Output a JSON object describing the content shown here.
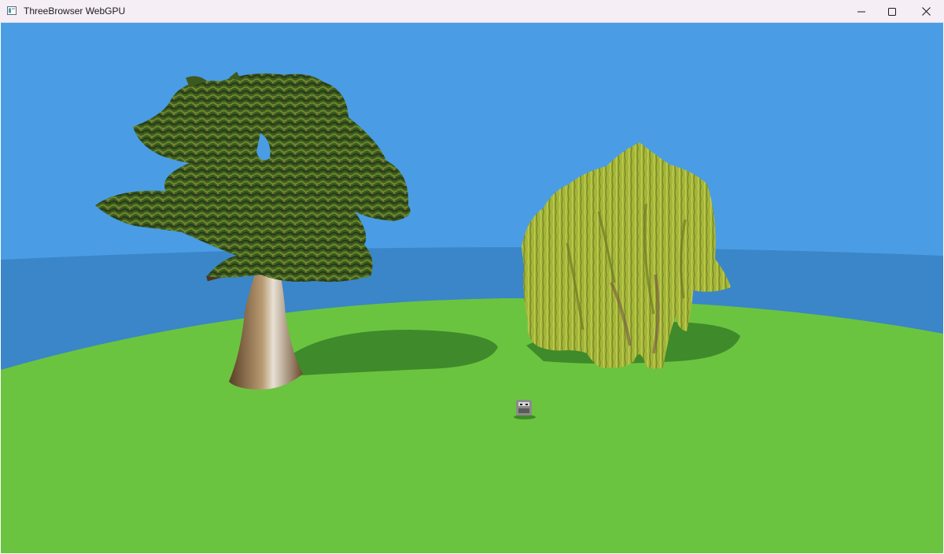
{
  "window": {
    "title": "ThreeBrowser WebGPU",
    "controls": {
      "minimize_icon": "minimize-icon",
      "maximize_icon": "maximize-icon",
      "close_icon": "close-icon"
    }
  },
  "scene": {
    "colors": {
      "sky": "#4a9de4",
      "horizon_water": "#3a86c8",
      "ground": "#6bc43f",
      "ground_shadow": "#3f8a2a",
      "tree1_canopy": "#3d5a1e",
      "tree1_trunk": "#7a5a3a",
      "tree2_canopy": "#a3b53a"
    },
    "objects": [
      {
        "name": "tree-1",
        "kind": "tree"
      },
      {
        "name": "tree-2",
        "kind": "willow tree"
      },
      {
        "name": "small-robot",
        "kind": "figure"
      }
    ]
  }
}
